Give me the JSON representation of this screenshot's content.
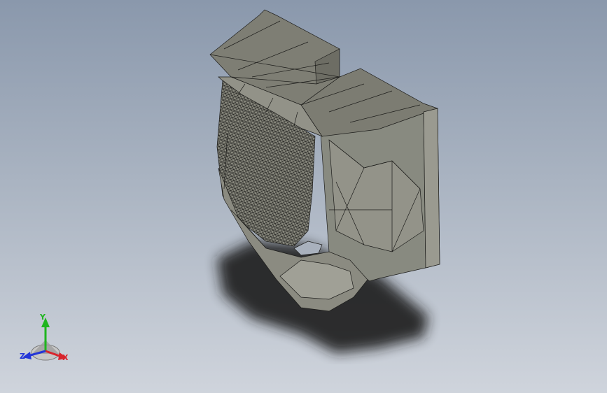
{
  "viewport": {
    "background_top": "#8a98ac",
    "background_bottom": "#cfd4dc"
  },
  "model": {
    "icon": "tessellated-mesh-part",
    "face_color": "#85857a",
    "edge_color": "#1c1c1a",
    "shadow_color": "#1a1a1a"
  },
  "triad": {
    "icon": "coordinate-triad-icon",
    "x_label": "X",
    "y_label": "Y",
    "z_label": "Z",
    "x_color": "#d8242c",
    "y_color": "#1fb51f",
    "z_color": "#2235d8"
  }
}
